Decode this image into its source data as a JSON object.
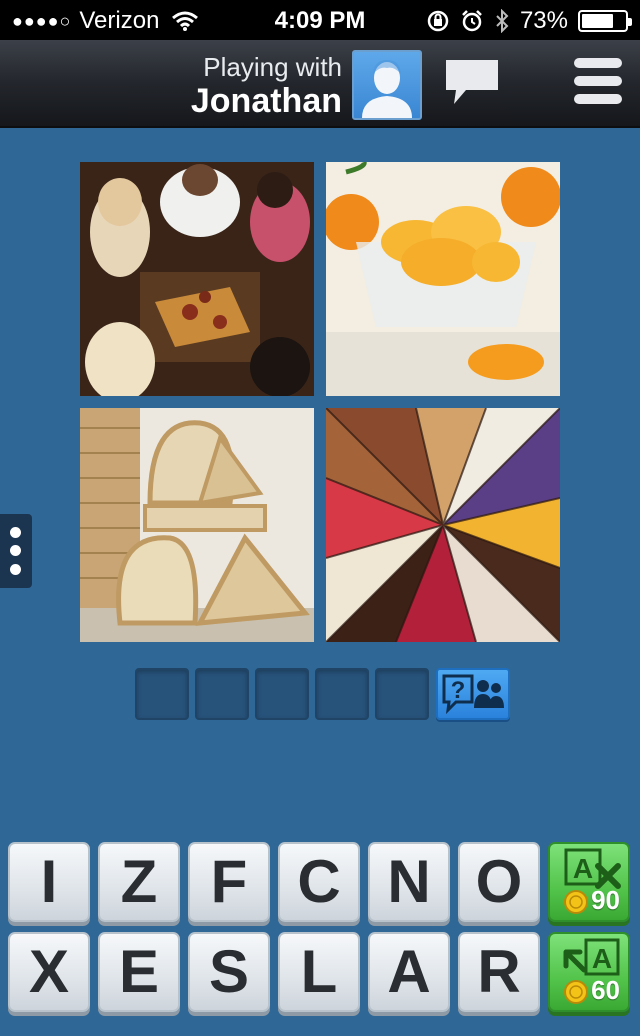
{
  "status_bar": {
    "signal_dots": "●●●●○",
    "carrier": "Verizon",
    "time": "4:09 PM",
    "battery": "73%",
    "battery_level": 0.73,
    "icons": [
      "wifi-icon",
      "orientation-lock-icon",
      "alarm-icon",
      "bluetooth-icon",
      "battery-icon"
    ]
  },
  "header": {
    "playing_with_label": "Playing with",
    "opponent_name": "Jonathan",
    "icons": [
      "avatar-icon",
      "chat-icon",
      "menu-icon"
    ]
  },
  "puzzle": {
    "pictures": [
      "people-sharing-pizza",
      "mandarin-orange-slices",
      "stacked-bread-slices",
      "cake-slices-wheel"
    ],
    "answer_length": 5,
    "hint_icon": "hint-friends-icon"
  },
  "keyboard": {
    "row1": [
      "I",
      "Z",
      "F",
      "C",
      "N",
      "O"
    ],
    "row2": [
      "X",
      "E",
      "S",
      "L",
      "A",
      "R"
    ]
  },
  "powerups": {
    "remove_letters": {
      "icon": "remove-letters-icon",
      "cost": "90"
    },
    "reveal_letter": {
      "icon": "reveal-letter-icon",
      "cost": "60"
    }
  },
  "colors": {
    "background": "#2f6797",
    "hint_blue": "#2b82dc",
    "powerup_green": "#52c34b"
  }
}
